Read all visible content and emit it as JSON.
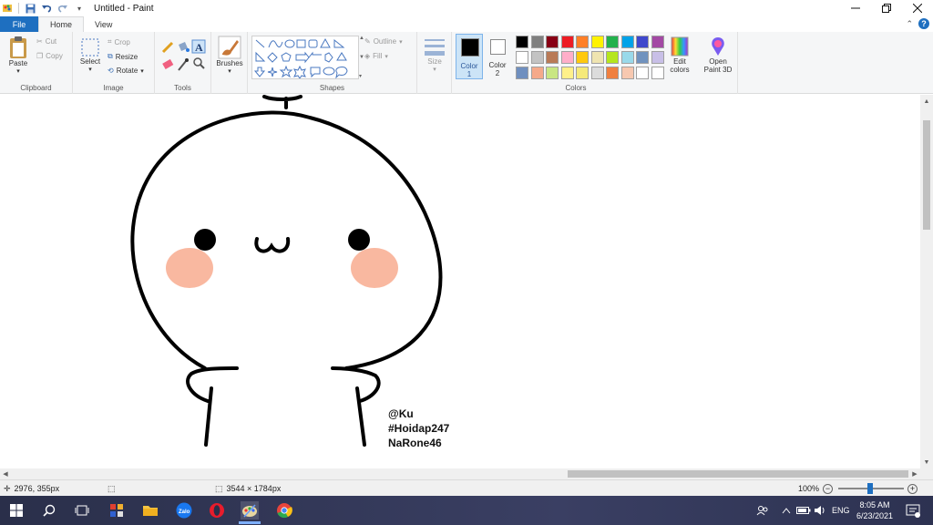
{
  "window": {
    "title": "Untitled - Paint"
  },
  "tabs": [
    {
      "label": "File"
    },
    {
      "label": "Home"
    },
    {
      "label": "View"
    }
  ],
  "ribbon": {
    "clipboard": {
      "paste": "Paste",
      "cut": "Cut",
      "copy": "Copy",
      "label": "Clipboard"
    },
    "image": {
      "select": "Select",
      "crop": "Crop",
      "resize": "Resize",
      "rotate": "Rotate",
      "label": "Image"
    },
    "tools": {
      "label": "Tools"
    },
    "brushes": {
      "label": "Brushes"
    },
    "shapes": {
      "outline": "Outline",
      "fill": "Fill",
      "label": "Shapes"
    },
    "size": {
      "label": "Size"
    },
    "color1": {
      "label1": "Color",
      "label2": "1",
      "color": "#000000"
    },
    "color2": {
      "label1": "Color",
      "label2": "2",
      "color": "#ffffff"
    },
    "colors": {
      "label": "Colors",
      "row1": [
        "#000000",
        "#7f7f7f",
        "#880015",
        "#ed1c24",
        "#ff7f27",
        "#fff200",
        "#22b14c",
        "#00a2e8",
        "#3f48cc",
        "#a349a4"
      ],
      "row2": [
        "#ffffff",
        "#c3c3c3",
        "#b97a57",
        "#ffaec9",
        "#ffc90e",
        "#efe4b0",
        "#b5e61d",
        "#99d9ea",
        "#7092be",
        "#c8bfe7"
      ],
      "row3": [
        "#6f8fbf",
        "#f5a98a",
        "#c9e682",
        "#fff08a",
        "#f5e97a",
        "#dcdcdc",
        "#f08040",
        "#f7c8b0",
        "#ffffff",
        "#ffffff"
      ],
      "edit": {
        "l1": "Edit",
        "l2": "colors"
      },
      "paint3d": {
        "l1": "Open",
        "l2": "Paint 3D"
      }
    }
  },
  "canvas": {
    "signature": [
      "@Ku",
      "#Hoidap247",
      "NaRone46"
    ],
    "cheek_color": "#f9b8a0"
  },
  "statusbar": {
    "cursor": "2976, 355px",
    "size": "3544 × 1784px",
    "zoom": "100%"
  },
  "taskbar": {
    "lang": "ENG",
    "time": "8:05 AM",
    "date": "6/23/2021"
  },
  "help": {
    "chevron": "⌃",
    "q": "?"
  }
}
